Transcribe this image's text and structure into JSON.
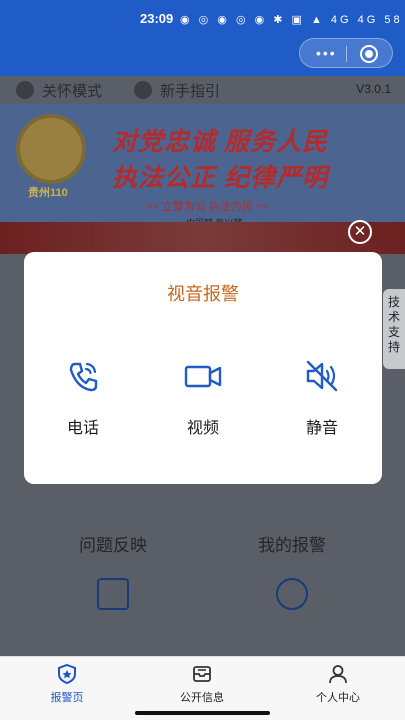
{
  "status_bar": {
    "time": "23:09",
    "icons_text": "◉ ◎ ◉ ◎ ◉ ✱ ▣ ▲ 4G 4G 58"
  },
  "header": {
    "menu_icon": "more-dots-icon",
    "target_icon": "target-icon"
  },
  "modebar": {
    "care_mode": "关怀模式",
    "guide": "新手指引",
    "version": "V3.0.1"
  },
  "banner": {
    "emblem_text": "贵州110",
    "title_line1": "对党忠诚 服务人民",
    "title_line2": "执法公正 纪律严明",
    "slogan": ">> 立警为公 执法为民 <<",
    "dream": "中国梦 复兴梦"
  },
  "side_tab": {
    "label": "技术支持"
  },
  "quick_links": {
    "feedback": "问题反映",
    "my_reports": "我的报警"
  },
  "modal": {
    "title": "视音报警",
    "options": [
      {
        "label": "电话",
        "icon": "phone-icon"
      },
      {
        "label": "视频",
        "icon": "video-camera-icon"
      },
      {
        "label": "静音",
        "icon": "mute-speaker-icon"
      }
    ],
    "close_icon": "close-icon"
  },
  "tabbar": {
    "tabs": [
      {
        "label": "报警页",
        "icon": "police-badge-icon",
        "active": true
      },
      {
        "label": "公开信息",
        "icon": "inbox-icon",
        "active": false
      },
      {
        "label": "个人中心",
        "icon": "person-icon",
        "active": false
      }
    ]
  },
  "colors": {
    "accent": "#1d55c9",
    "modal_title": "#c8671f",
    "icon_blue": "#1f5cc7"
  }
}
